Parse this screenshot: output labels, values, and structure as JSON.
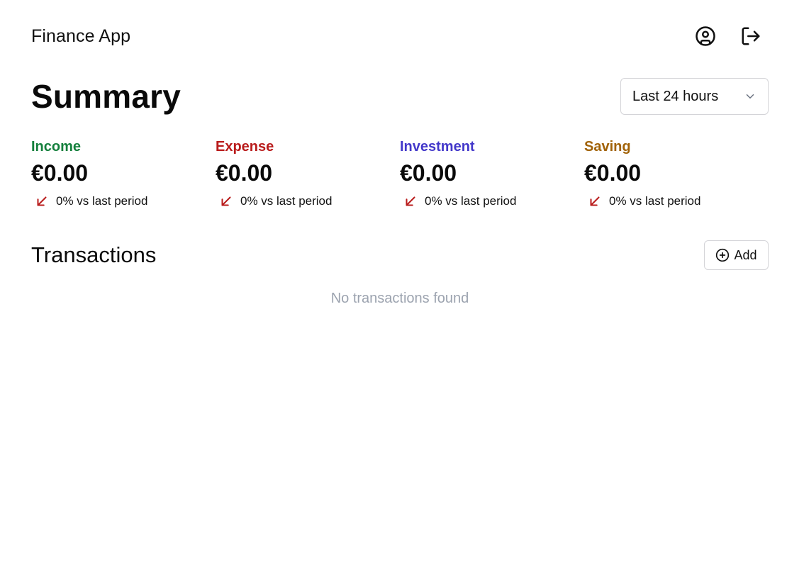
{
  "app": {
    "title": "Finance App"
  },
  "header": {
    "profile_icon": "user-circle-icon",
    "logout_icon": "log-out-icon"
  },
  "summary": {
    "title": "Summary",
    "period": {
      "selected": "Last 24 hours",
      "icon": "chevron-down-icon"
    },
    "stats": [
      {
        "label": "Income",
        "value": "€0.00",
        "change": "0% vs last period",
        "color": "#15803d"
      },
      {
        "label": "Expense",
        "value": "€0.00",
        "change": "0% vs last period",
        "color": "#b91c1c"
      },
      {
        "label": "Investment",
        "value": "€0.00",
        "change": "0% vs last period",
        "color": "#4338ca"
      },
      {
        "label": "Saving",
        "value": "€0.00",
        "change": "0% vs last period",
        "color": "#a16207"
      }
    ],
    "change_arrow_icon": "arrow-down-left-icon",
    "change_color": "#b91c1c"
  },
  "transactions": {
    "title": "Transactions",
    "add_label": "Add",
    "add_icon": "plus-circle-icon",
    "empty_text": "No transactions found"
  }
}
